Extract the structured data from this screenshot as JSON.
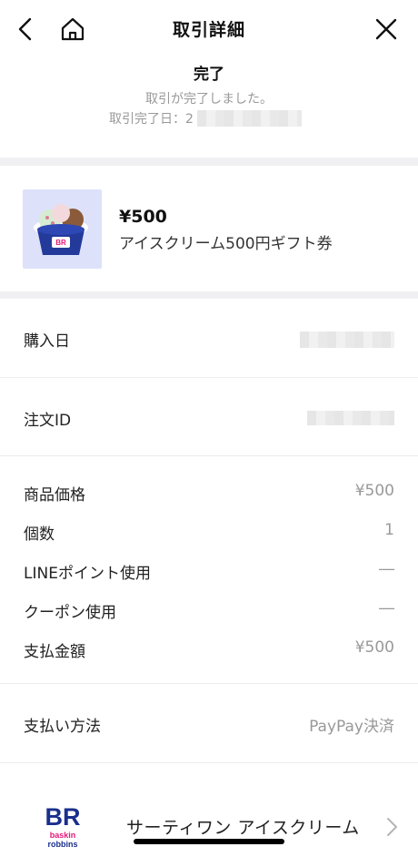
{
  "header": {
    "title": "取引詳細",
    "back_icon": "chevron-left-icon",
    "home_icon": "home-icon",
    "close_icon": "close-icon"
  },
  "status": {
    "title": "完了",
    "message": "取引が完了しました。",
    "date_label": "取引完了日：2"
  },
  "product": {
    "price": "¥500",
    "name": "アイスクリーム500円ギフト券"
  },
  "rows": {
    "purchase_date": {
      "label": "購入日",
      "value": ""
    },
    "order_id": {
      "label": "注文ID",
      "value": ""
    },
    "item_price": {
      "label": "商品価格",
      "value": "¥500"
    },
    "quantity": {
      "label": "個数",
      "value": "1"
    },
    "line_points": {
      "label": "LINEポイント使用",
      "value": "―"
    },
    "coupon": {
      "label": "クーポン使用",
      "value": "―"
    },
    "total": {
      "label": "支払金額",
      "value": "¥500"
    },
    "payment_method": {
      "label": "支払い方法",
      "value": "PayPay決済"
    }
  },
  "shop": {
    "name": "サーティワン アイスクリーム",
    "logo_text_top": "BR",
    "logo_text_bottom": "baskin robbins",
    "brand_blue": "#1a2f8c",
    "brand_pink": "#e4187a"
  }
}
